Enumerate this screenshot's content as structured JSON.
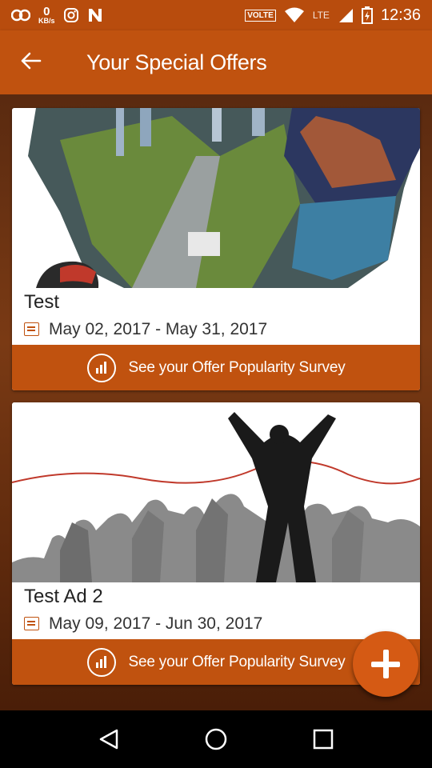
{
  "status_bar": {
    "speed_value": "0",
    "speed_unit": "KB/s",
    "volte": "VOLTE",
    "lte": "LTE",
    "time": "12:36"
  },
  "app_bar": {
    "title": "Your Special Offers"
  },
  "offers": [
    {
      "title": "Test",
      "date_range": "May 02, 2017 - May 31, 2017",
      "survey_label": "See your Offer Popularity Survey"
    },
    {
      "title": "Test Ad 2",
      "date_range": "May 09, 2017 - Jun 30, 2017",
      "survey_label": "See your Offer Popularity Survey"
    }
  ],
  "colors": {
    "primary": "#c0520f",
    "status_bar": "#b84c0d",
    "fab": "#d55a14"
  },
  "icons": {
    "back": "arrow-left-icon",
    "calendar": "calendar-icon",
    "survey": "chart-circle-icon",
    "fab": "plus-icon"
  }
}
